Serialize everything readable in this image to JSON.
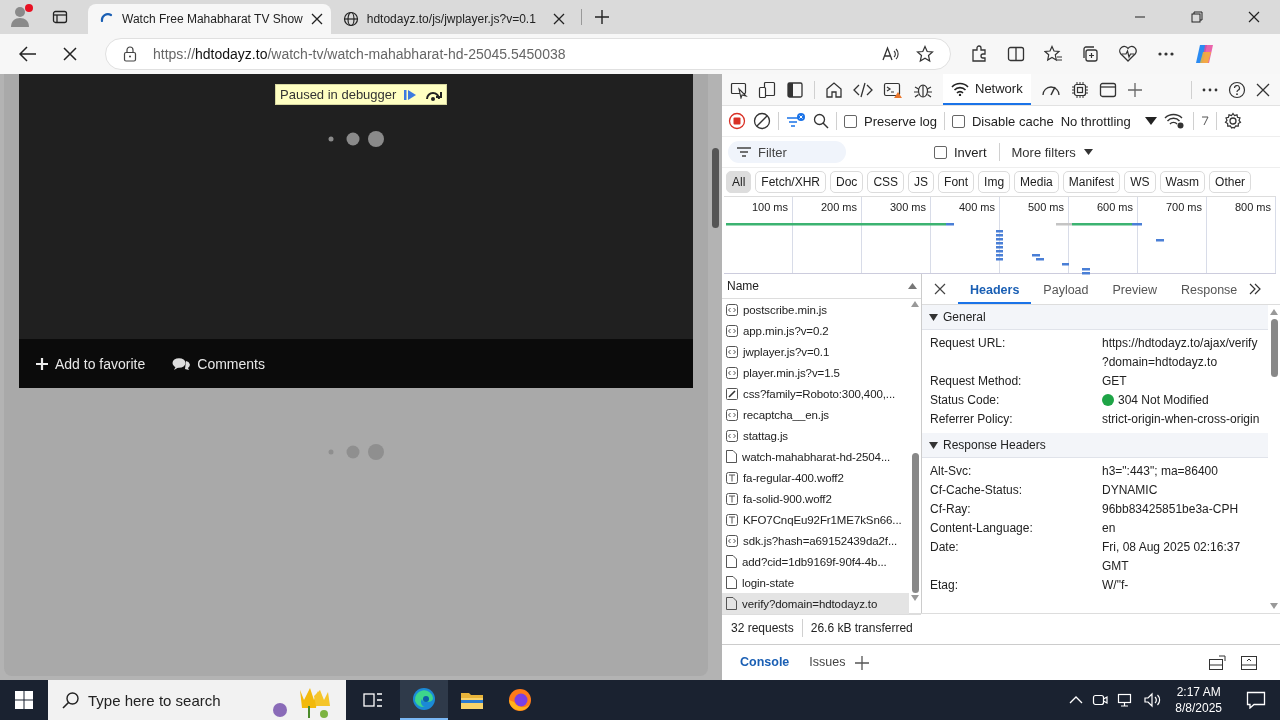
{
  "browser": {
    "tabs": [
      {
        "title": "Watch Free Mahabharat TV Show",
        "selected": true,
        "loading": true
      },
      {
        "title": "hdtodayz.to/js/jwplayer.js?v=0.1",
        "selected": false,
        "loading": false
      }
    ],
    "address": {
      "scheme": "https://",
      "host": "hdtodayz.to",
      "path": "/watch-tv/watch-mahabharat-hd-25045.5450038"
    }
  },
  "page": {
    "debugger_banner": "Paused in debugger",
    "player_actions": [
      {
        "label": "Add to favorite",
        "kind": "favorite"
      },
      {
        "label": "Comments",
        "kind": "comments"
      }
    ]
  },
  "devtools": {
    "panel_tabs": [
      {
        "label": "Network",
        "selected": true
      }
    ],
    "preserve_log": {
      "label": "Preserve log",
      "checked": false
    },
    "disable_cache": {
      "label": "Disable cache",
      "checked": false
    },
    "throttling": "No throttling",
    "filter": {
      "placeholder": "Filter"
    },
    "invert": {
      "label": "Invert",
      "checked": false
    },
    "more_filters": "More filters",
    "type_filters": [
      {
        "label": "All",
        "selected": true
      },
      {
        "label": "Fetch/XHR",
        "selected": false
      },
      {
        "label": "Doc",
        "selected": false
      },
      {
        "label": "CSS",
        "selected": false
      },
      {
        "label": "JS",
        "selected": false
      },
      {
        "label": "Font",
        "selected": false
      },
      {
        "label": "Img",
        "selected": false
      },
      {
        "label": "Media",
        "selected": false
      },
      {
        "label": "Manifest",
        "selected": false
      },
      {
        "label": "WS",
        "selected": false
      },
      {
        "label": "Wasm",
        "selected": false
      },
      {
        "label": "Other",
        "selected": false
      }
    ],
    "timeline_ticks": [
      "100 ms",
      "200 ms",
      "300 ms",
      "400 ms",
      "500 ms",
      "600 ms",
      "700 ms",
      "800 ms"
    ],
    "name_column": "Name",
    "requests": [
      {
        "name": "postscribe.min.js",
        "kind": "script",
        "selected": false
      },
      {
        "name": "app.min.js?v=0.2",
        "kind": "script",
        "selected": false
      },
      {
        "name": "jwplayer.js?v=0.1",
        "kind": "script",
        "selected": false
      },
      {
        "name": "player.min.js?v=1.5",
        "kind": "script",
        "selected": false
      },
      {
        "name": "css?family=Roboto:300,400,...",
        "kind": "stylesheet",
        "selected": false
      },
      {
        "name": "recaptcha__en.js",
        "kind": "script",
        "selected": false
      },
      {
        "name": "stattag.js",
        "kind": "script",
        "selected": false
      },
      {
        "name": "watch-mahabharat-hd-2504...",
        "kind": "document",
        "selected": false
      },
      {
        "name": "fa-regular-400.woff2",
        "kind": "font",
        "selected": false
      },
      {
        "name": "fa-solid-900.woff2",
        "kind": "font",
        "selected": false
      },
      {
        "name": "KFO7CnqEu92Fr1ME7kSn66...",
        "kind": "font",
        "selected": false
      },
      {
        "name": "sdk.js?hash=a69152439da2f...",
        "kind": "script",
        "selected": false
      },
      {
        "name": "add?cid=1db9169f-90f4-4b...",
        "kind": "document",
        "selected": false
      },
      {
        "name": "login-state",
        "kind": "document",
        "selected": false
      },
      {
        "name": "verify?domain=hdtodayz.to",
        "kind": "document",
        "selected": true
      }
    ],
    "summary": [
      "32 requests",
      "26.6 kB transferred"
    ],
    "detail_tabs": [
      {
        "label": "Headers",
        "selected": true
      },
      {
        "label": "Payload",
        "selected": false
      },
      {
        "label": "Preview",
        "selected": false
      },
      {
        "label": "Response",
        "selected": false
      }
    ],
    "sections": [
      {
        "title": "General",
        "expanded": true,
        "rows": [
          {
            "key": "Request URL:",
            "value": "https://hdtodayz.to/ajax/verify?domain=hdtodayz.to"
          },
          {
            "key": "Request Method:",
            "value": "GET"
          },
          {
            "key": "Status Code:",
            "value": "304 Not Modified",
            "color": "#1ea446"
          },
          {
            "key": "Referrer Policy:",
            "value": "strict-origin-when-cross-origin"
          }
        ]
      },
      {
        "title": "Response Headers",
        "expanded": true,
        "rows": [
          {
            "key": "Alt-Svc:",
            "value": "h3=\":443\"; ma=86400"
          },
          {
            "key": "Cf-Cache-Status:",
            "value": "DYNAMIC"
          },
          {
            "key": "Cf-Ray:",
            "value": "96bb83425851be3a-CPH"
          },
          {
            "key": "Content-Language:",
            "value": "en"
          },
          {
            "key": "Date:",
            "value": "Fri, 08 Aug 2025 02:16:37 GMT"
          },
          {
            "key": "Etag:",
            "value": "W/\"f-"
          }
        ]
      }
    ],
    "drawer_tabs": [
      {
        "label": "Console",
        "selected": true
      },
      {
        "label": "Issues",
        "selected": false
      }
    ]
  },
  "taskbar": {
    "search": {
      "placeholder": "Type here to search"
    },
    "apps": [
      {
        "kind": "edge",
        "active": true
      },
      {
        "kind": "explorer",
        "active": false
      },
      {
        "kind": "firefox",
        "active": false
      }
    ],
    "time": "2:17 AM",
    "date": "8/8/2025"
  }
}
